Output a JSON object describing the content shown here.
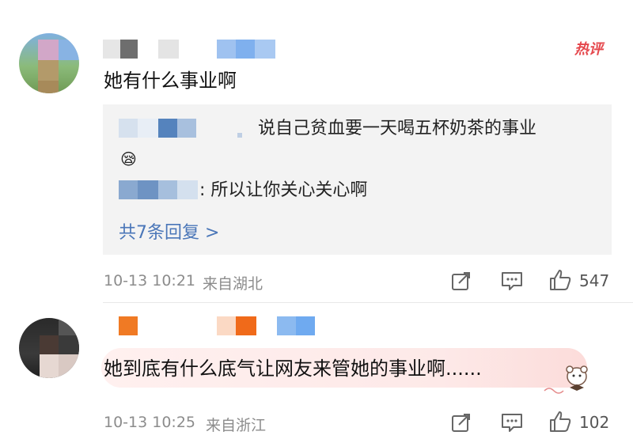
{
  "top_partial": "▔▔ ▔▔▔▔",
  "hot_badge": "热评",
  "comments": [
    {
      "text": "她有什么事业啊",
      "replies": [
        {
          "text": "说自己贫血要一天喝五杯奶茶的事业",
          "emoji": "😪"
        },
        {
          "text": ": 所以让你关心关心啊"
        }
      ],
      "more_replies": "共7条回复 >",
      "time": "10-13 10:21",
      "location": "来自湖北",
      "likes": "547"
    },
    {
      "text": "她到底有什么底气让网友来管她的事业啊......",
      "time": "10-13 10:25",
      "location": "来自浙江",
      "likes": "102"
    }
  ],
  "icons": [
    "share-icon",
    "comment-icon",
    "like-icon"
  ],
  "colors": {
    "link": "#4a76b8",
    "hot": "#e5484d",
    "meta": "#8c8c8c",
    "reply_bg": "#f3f3f3"
  }
}
